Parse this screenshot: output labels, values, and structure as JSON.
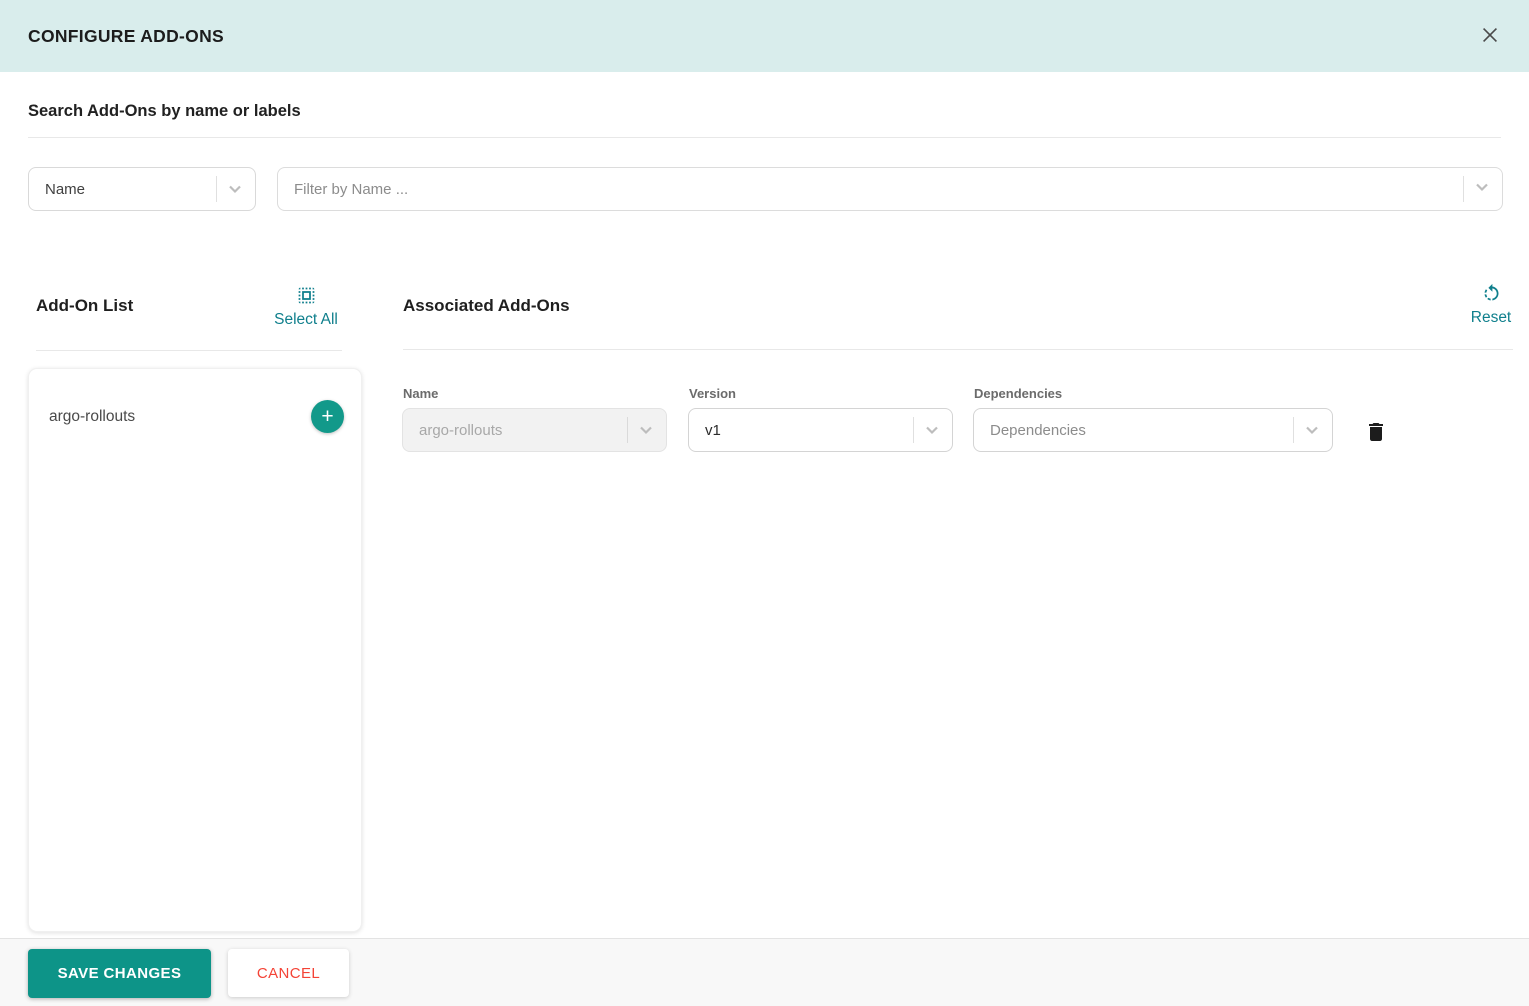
{
  "header": {
    "title": "CONFIGURE ADD-ONS"
  },
  "search": {
    "heading": "Search Add-Ons by name or labels",
    "field_selector": {
      "value": "Name"
    },
    "filter_input": {
      "placeholder": "Filter by Name ...",
      "value": ""
    }
  },
  "addon_list": {
    "title": "Add-On List",
    "select_all_label": "Select All",
    "items": [
      {
        "name": "argo-rollouts",
        "add_label": "+"
      }
    ]
  },
  "associated": {
    "title": "Associated Add-Ons",
    "reset_label": "Reset",
    "rows": [
      {
        "name_label": "Name",
        "name_value": "argo-rollouts",
        "version_label": "Version",
        "version_value": "v1",
        "dependencies_label": "Dependencies",
        "dependencies_value": "Dependencies"
      }
    ]
  },
  "footer": {
    "save_label": "SAVE CHANGES",
    "cancel_label": "CANCEL"
  },
  "icons": {
    "close": "close-icon",
    "chevron": "chevron-down-icon",
    "select_all": "select-all-icon",
    "reset": "rotate-left-icon",
    "plus": "plus-icon",
    "trash": "trash-icon"
  },
  "colors": {
    "header_bg": "#d9edec",
    "accent_teal": "#0d9488",
    "link_teal": "#0f7f8c",
    "plus_teal": "#12998a",
    "cancel_red": "#f44336",
    "disabled_bg": "#f2f2f2",
    "border": "#d9d9d9",
    "footer_bg": "#f8f8f8"
  }
}
